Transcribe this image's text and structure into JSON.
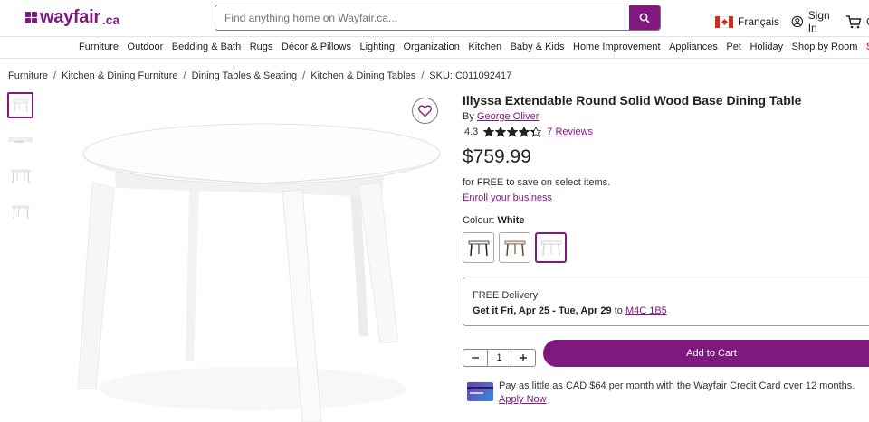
{
  "header": {
    "logo_text": "wayfair",
    "logo_tld": ".ca",
    "search_placeholder": "Find anything home on Wayfair.ca...",
    "language": "Français",
    "sign_in": "Sign In",
    "cart_label": "C",
    "brand_color": "#7f187f"
  },
  "nav": {
    "items": [
      "Furniture",
      "Outdoor",
      "Bedding & Bath",
      "Rugs",
      "Décor & Pillows",
      "Lighting",
      "Organization",
      "Kitchen",
      "Baby & Kids",
      "Home Improvement",
      "Appliances",
      "Pet",
      "Holiday",
      "Shop by Room",
      "Sale"
    ]
  },
  "breadcrumb": {
    "items": [
      "Furniture",
      "Kitchen & Dining Furniture",
      "Dining Tables & Seating",
      "Kitchen & Dining Tables",
      "SKU: C011092417"
    ]
  },
  "product": {
    "title": "Illyssa Extendable Round Solid Wood Base Dining Table",
    "by_prefix": "By",
    "brand": "George Oliver",
    "rating": "4.3",
    "rating_value": 4.3,
    "reviews": "7 Reviews",
    "price": "$759.99",
    "promo": "for FREE to save on select items.",
    "enroll": "Enroll your business",
    "colour_label": "Colour:",
    "colour_value": "White",
    "swatches": [
      "black",
      "brown",
      "white"
    ],
    "selected_swatch": "white"
  },
  "delivery": {
    "title": "FREE Delivery",
    "dates": "Get it Fri, Apr 25 - Tue, Apr 29",
    "to": "to",
    "postal": "M4C 1B5"
  },
  "purchase": {
    "quantity": "1",
    "add_to_cart": "Add to Cart"
  },
  "credit": {
    "text": "Pay as little as CAD $64 per month with the Wayfair Credit Card over 12 months.",
    "apply": "Apply Now"
  },
  "icons": {
    "search": "search-icon",
    "account": "account-icon",
    "cart": "cart-icon",
    "heart": "heart-icon",
    "minus": "minus-icon",
    "plus": "plus-icon",
    "star": "star-icon"
  }
}
